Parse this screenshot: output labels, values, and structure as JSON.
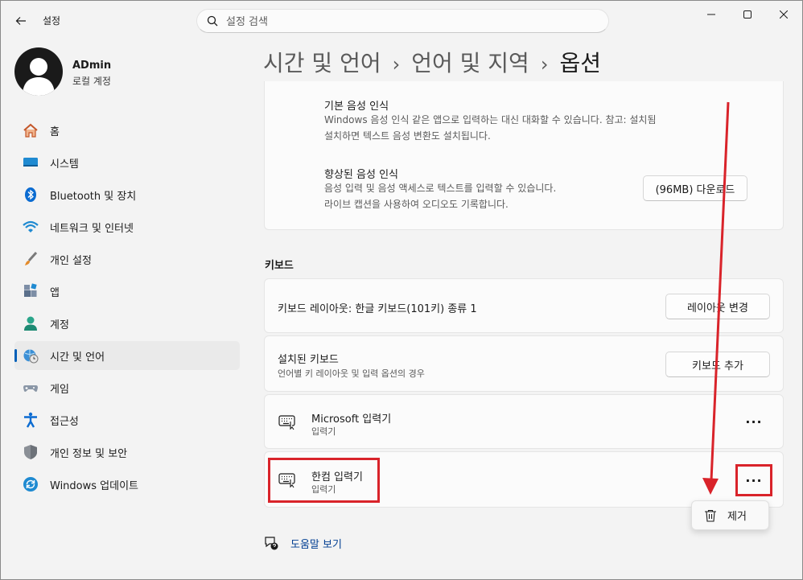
{
  "window": {
    "title": "설정",
    "search_placeholder": "설정 검색"
  },
  "profile": {
    "name": "ADmin",
    "account_type": "로컬 계정"
  },
  "sidebar": {
    "items": [
      {
        "label": "홈",
        "icon": "home-icon"
      },
      {
        "label": "시스템",
        "icon": "system-icon"
      },
      {
        "label": "Bluetooth 및 장치",
        "icon": "bluetooth-icon"
      },
      {
        "label": "네트워크 및 인터넷",
        "icon": "wifi-icon"
      },
      {
        "label": "개인 설정",
        "icon": "brush-icon"
      },
      {
        "label": "앱",
        "icon": "apps-icon"
      },
      {
        "label": "계정",
        "icon": "account-icon"
      },
      {
        "label": "시간 및 언어",
        "icon": "time-language-icon",
        "active": true
      },
      {
        "label": "게임",
        "icon": "gamepad-icon"
      },
      {
        "label": "접근성",
        "icon": "accessibility-icon"
      },
      {
        "label": "개인 정보 및 보안",
        "icon": "shield-icon"
      },
      {
        "label": "Windows 업데이트",
        "icon": "update-icon"
      }
    ]
  },
  "breadcrumb": {
    "items": [
      "시간 및 언어",
      "언어 및 지역"
    ],
    "current": "옵션"
  },
  "speech": {
    "basic_title": "기본 음성 인식",
    "basic_desc_line1": "Windows 음성 인식 같은 앱으로 입력하는 대신 대화할 수 있습니다. 참고:     설치됨",
    "basic_desc_line2": "설치하면 텍스트 음성 변환도 설치됩니다.",
    "enhanced_title": "향상된 음성 인식",
    "enhanced_desc_line1": "음성 입력 및 음성 액세스로 텍스트를 입력할 수 있습니다.",
    "enhanced_desc_line2": "라이브 캡션을 사용하여 오디오도 기록합니다.",
    "download_button": "(96MB) 다운로드"
  },
  "keyboard": {
    "section_title": "키보드",
    "layout_label": "키보드 레이아웃: 한글 키보드(101키) 종류 1",
    "layout_button": "레이아웃 변경",
    "installed_title": "설치된 키보드",
    "installed_sub": "언어별 키 레이아웃 및 입력 옵션의 경우",
    "add_button": "키보드 추가",
    "ime_items": [
      {
        "name": "Microsoft 입력기",
        "sub": "입력기"
      },
      {
        "name": "한컴 입력기",
        "sub": "입력기"
      }
    ],
    "more_label": "···"
  },
  "context_menu": {
    "remove_label": "제거"
  },
  "help": {
    "label": "도움말 보기"
  },
  "colors": {
    "accent": "#005fb8",
    "annotation_red": "#d9232a"
  }
}
